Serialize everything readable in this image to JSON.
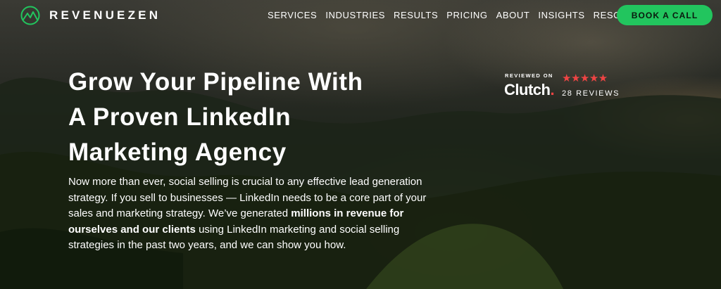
{
  "brand": {
    "name": "REVENUEZEN",
    "accent_color": "#22c55e"
  },
  "nav": {
    "items": [
      {
        "label": "SERVICES"
      },
      {
        "label": "INDUSTRIES"
      },
      {
        "label": "RESULTS"
      },
      {
        "label": "PRICING"
      },
      {
        "label": "ABOUT"
      },
      {
        "label": "INSIGHTS"
      },
      {
        "label": "RESOURCES"
      }
    ],
    "cta_label": "BOOK A CALL"
  },
  "hero": {
    "headline_lines": [
      "Grow Your Pipeline With",
      "A Proven LinkedIn",
      "Marketing Agency"
    ],
    "body_part1": "Now more than ever, social selling is crucial to any effective lead generation strategy. If you sell to businesses — LinkedIn needs to be a core part of your sales and marketing strategy. We’ve generated ",
    "body_bold": "millions in revenue for ourselves and our clients",
    "body_part2": " using LinkedIn marketing and social selling strategies in the past two years, and we can show you how."
  },
  "clutch": {
    "reviewed_on": "REVIEWED ON",
    "logo_text": "Clutch",
    "logo_dot": ".",
    "stars": "★★★★★",
    "star_count": 5,
    "star_color": "#ef4444",
    "reviews": "28 REVIEWS"
  }
}
